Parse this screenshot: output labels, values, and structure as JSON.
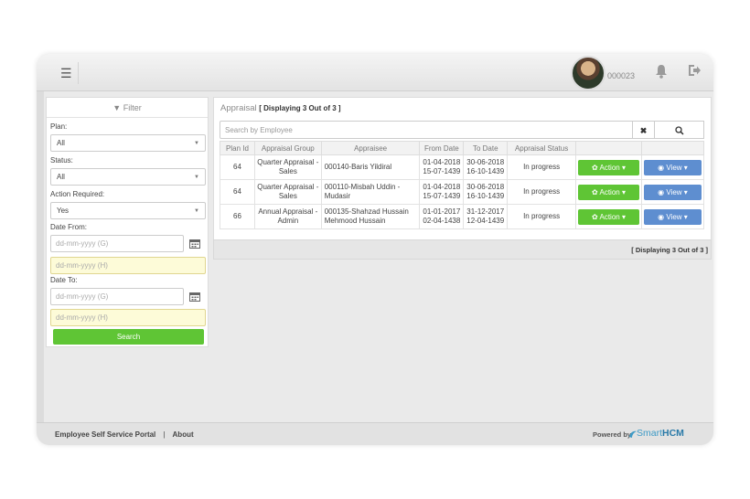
{
  "header": {
    "menu_icon": "hamburger-icon",
    "user_id": "000023",
    "bell_icon": "bell-icon",
    "signout_icon": "sign-out-icon"
  },
  "filter": {
    "title": "Filter",
    "plan_label": "Plan:",
    "plan_value": "All",
    "status_label": "Status:",
    "status_value": "All",
    "action_label": "Action Required:",
    "action_value": "Yes",
    "date_from_label": "Date From:",
    "date_from_g_placeholder": "dd-mm-yyyy (G)",
    "date_from_h_placeholder": "dd-mm-yyyy (H)",
    "date_to_label": "Date To:",
    "date_to_g_placeholder": "dd-mm-yyyy (G)",
    "date_to_h_placeholder": "dd-mm-yyyy (H)",
    "search_button": "Search"
  },
  "appraisal": {
    "title": "Appraisal",
    "display_count": "[ Displaying 3 Out of 3 ]",
    "search_placeholder": "Search by Employee",
    "clear_label": "✖",
    "columns": [
      "Plan Id",
      "Appraisal Group",
      "Appraisee",
      "From Date",
      "To Date",
      "Appraisal Status",
      "",
      ""
    ],
    "rows": [
      {
        "plan_id": "64",
        "group_1": "Quarter Appraisal -",
        "group_2": "Sales",
        "appraisee_1": "000140-Baris Yildiral",
        "appraisee_2": "",
        "from_1": "01-04-2018",
        "from_2": "15-07-1439",
        "to_1": "30-06-2018",
        "to_2": "16-10-1439",
        "status": "In progress",
        "action": "Action",
        "view": "View"
      },
      {
        "plan_id": "64",
        "group_1": "Quarter Appraisal -",
        "group_2": "Sales",
        "appraisee_1": "000110-Misbah Uddin -",
        "appraisee_2": "Mudasir",
        "from_1": "01-04-2018",
        "from_2": "15-07-1439",
        "to_1": "30-06-2018",
        "to_2": "16-10-1439",
        "status": "In progress",
        "action": "Action",
        "view": "View"
      },
      {
        "plan_id": "66",
        "group_1": "Annual Appraisal -",
        "group_2": "Admin",
        "appraisee_1": "000135-Shahzad Hussain",
        "appraisee_2": "Mehmood Hussain",
        "from_1": "01-01-2017",
        "from_2": "02-04-1438",
        "to_1": "31-12-2017",
        "to_2": "12-04-1439",
        "status": "In progress",
        "action": "Action",
        "view": "View"
      }
    ],
    "pager_text": "[ Displaying 3 Out of 3 ]"
  },
  "footer": {
    "portal_link": "Employee Self Service Portal",
    "separator": "|",
    "about_link": "About",
    "powered_by": "Powered by",
    "brand_smart": "Smart",
    "brand_hcm": "HCM"
  },
  "colors": {
    "green": "#5fc535",
    "blue": "#5e8ed0",
    "brand": "#3d9ac6"
  }
}
